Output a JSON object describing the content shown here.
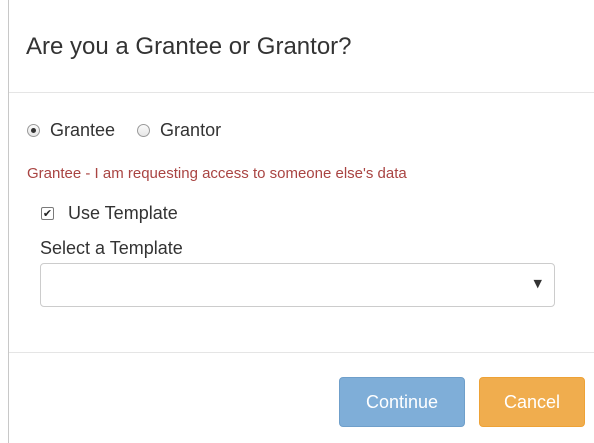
{
  "dialog": {
    "title": "Are you a Grantee or Grantor?"
  },
  "role": {
    "options": [
      {
        "label": "Grantee",
        "selected": true
      },
      {
        "label": "Grantor",
        "selected": false
      }
    ],
    "help_text": "Grantee - I am requesting access to someone else's data"
  },
  "template": {
    "use_template_label": "Use Template",
    "use_template_checked": true,
    "select_label": "Select a Template",
    "selected_value": ""
  },
  "footer": {
    "continue_label": "Continue",
    "cancel_label": "Cancel"
  },
  "colors": {
    "help_text": "#a94442",
    "continue_button": "#7faed8",
    "cancel_button": "#f0ad4e"
  }
}
